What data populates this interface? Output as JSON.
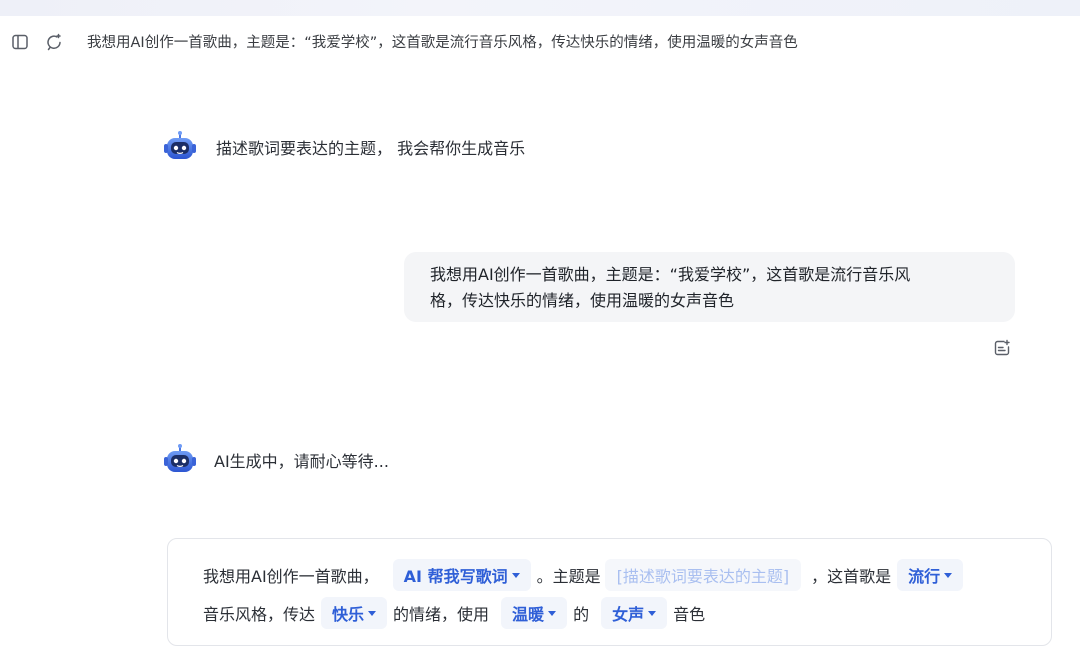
{
  "header": {
    "title": "我想用AI创作一首歌曲，主题是：“我爱学校”，这首歌是流行音乐风格，传达快乐的情绪，使用温暖的女声音色",
    "icons": [
      "sidebar-toggle-icon",
      "new-chat-icon"
    ]
  },
  "messages": {
    "bot_intro": "描述歌词要表达的主题， 我会帮你生成音乐",
    "user_line1": "我想用AI创作一首歌曲，主题是：“我爱学校”，这首歌是流行音乐风",
    "user_line2": "格，传达快乐的情绪，使用温暖的女声音色",
    "bot_status": "AI生成中，请耐心等待..."
  },
  "prompt": {
    "seg1": "我想用AI创作一首歌曲，",
    "lyrics_chip": "AI 帮我写歌词",
    "seg2": "。主题是",
    "theme_placeholder": "[描述歌词要表达的主题]",
    "seg3": "，这首歌是",
    "style_chip": "流行",
    "seg4": "音乐风格，传达",
    "mood_chip": "快乐",
    "seg5": "的情绪，使用",
    "voice_tone_chip": "温暖",
    "seg6": "的",
    "voice_chip": "女声",
    "seg7": "音色"
  },
  "colors": {
    "accent": "#2f5fd7",
    "chip_bg": "#f2f5fb",
    "placeholder": "#a9bff0",
    "bubble_bg": "#f4f5f7"
  }
}
